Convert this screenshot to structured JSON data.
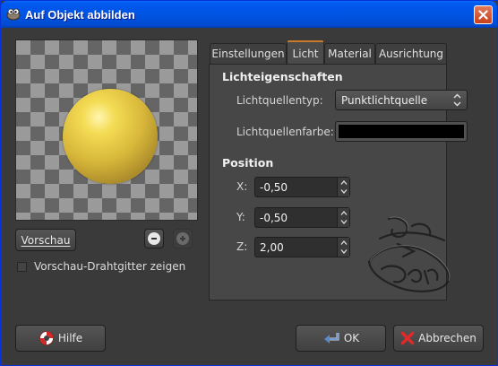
{
  "window": {
    "title": "Auf Objekt abbilden",
    "title_bar_color": "#0054e3"
  },
  "preview": {
    "preview_button": "Vorschau",
    "wireframe_checkbox": {
      "label": "Vorschau-Drahtgitter zeigen",
      "checked": false
    },
    "sphere_color": "#e6c84a"
  },
  "tabs": [
    {
      "label": "Einstellungen",
      "active": false
    },
    {
      "label": "Licht",
      "active": true
    },
    {
      "label": "Material",
      "active": false
    },
    {
      "label": "Ausrichtung",
      "active": false
    }
  ],
  "light": {
    "section_title": "Lichteigenschaften",
    "type_label": "Lichtquellentyp:",
    "type_value": "Punktlichtquelle",
    "color_label": "Lichtquellenfarbe:",
    "color_value": "#000000"
  },
  "position": {
    "section_title": "Position",
    "x_label": "X:",
    "x_value": "-0,50",
    "y_label": "Y:",
    "y_value": "-0,50",
    "z_label": "Z:",
    "z_value": "2,00"
  },
  "buttons": {
    "help": "Hilfe",
    "ok": "OK",
    "cancel": "Abbrechen"
  }
}
